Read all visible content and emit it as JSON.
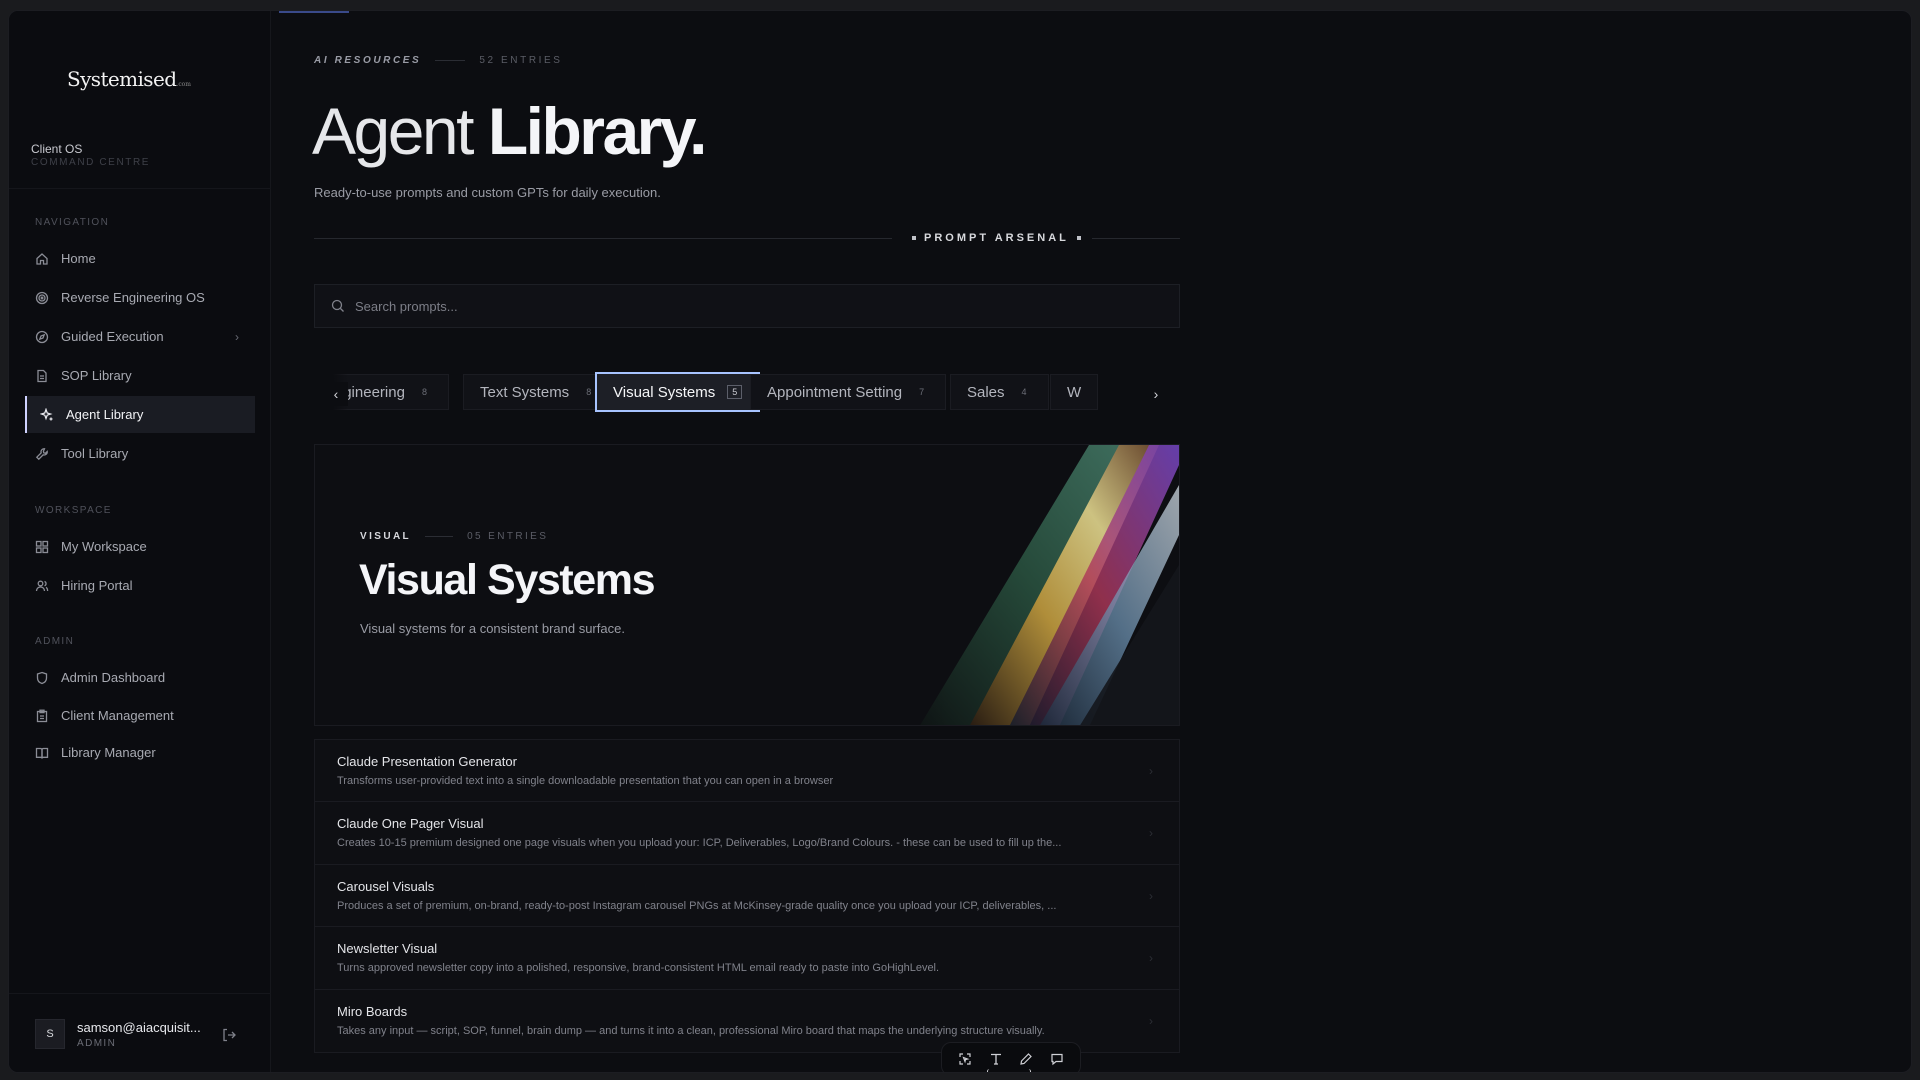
{
  "sidebar": {
    "logo": "Systemised",
    "logo_suffix": ".com",
    "client_title": "Client OS",
    "client_subtitle": "COMMAND CENTRE",
    "sections": {
      "navigation": "NAVIGATION",
      "workspace": "WORKSPACE",
      "admin": "ADMIN"
    },
    "nav": [
      {
        "label": "Home",
        "icon": "home-icon"
      },
      {
        "label": "Reverse Engineering OS",
        "icon": "target-icon"
      },
      {
        "label": "Guided Execution",
        "icon": "compass-icon"
      },
      {
        "label": "SOP Library",
        "icon": "document-icon"
      },
      {
        "label": "Agent Library",
        "icon": "sparkle-icon",
        "active": true
      },
      {
        "label": "Tool Library",
        "icon": "wrench-icon"
      }
    ],
    "workspace": [
      {
        "label": "My Workspace",
        "icon": "grid-icon"
      },
      {
        "label": "Hiring Portal",
        "icon": "users-icon"
      }
    ],
    "admin": [
      {
        "label": "Admin Dashboard",
        "icon": "shield-icon"
      },
      {
        "label": "Client Management",
        "icon": "clipboard-icon"
      },
      {
        "label": "Library Manager",
        "icon": "book-icon"
      }
    ],
    "user": {
      "initial": "S",
      "email": "samson@aiacquisit...",
      "role": "ADMIN"
    }
  },
  "header": {
    "kicker": "AI RESOURCES",
    "entries": "52 ENTRIES",
    "title_light": "Agent",
    "title_bold": "Library.",
    "subtitle": "Ready-to-use prompts and custom GPTs for daily execution.",
    "arsenal": "PROMPT ARSENAL"
  },
  "search": {
    "placeholder": "Search prompts..."
  },
  "tabs": [
    {
      "label": "Context Engineering",
      "count": "8"
    },
    {
      "label": "Text Systems",
      "count": "8"
    },
    {
      "label": "Visual Systems",
      "count": "5",
      "active": true
    },
    {
      "label": "Appointment Setting",
      "count": "7"
    },
    {
      "label": "Sales",
      "count": "4"
    },
    {
      "label": "W",
      "count": ""
    }
  ],
  "hero": {
    "kicker": "VISUAL",
    "entries": "05 ENTRIES",
    "title": "Visual Systems",
    "description": "Visual systems for a consistent brand surface."
  },
  "prompts": [
    {
      "title": "Claude Presentation Generator",
      "description": "Transforms user-provided text into a single downloadable presentation that you can open in a browser"
    },
    {
      "title": "Claude One Pager Visual",
      "description": "Creates 10-15 premium designed one page visuals when you upload your: ICP, Deliverables, Logo/Brand Colours. - these can be used to fill up the..."
    },
    {
      "title": "Carousel Visuals",
      "description": "Produces a set of premium, on-brand, ready-to-post Instagram carousel PNGs at McKinsey-grade quality once you upload your ICP, deliverables, ..."
    },
    {
      "title": "Newsletter Visual",
      "description": "Turns approved newsletter copy into a polished, responsive, brand-consistent HTML email ready to paste into GoHighLevel."
    },
    {
      "title": "Miro Boards",
      "description": "Takes any input — script, SOP, funnel, brain dump — and turns it into a clean, professional Miro board that maps the underlying structure visually."
    }
  ],
  "toolbar": [
    "select-icon",
    "text-icon",
    "pen-icon",
    "comment-icon"
  ]
}
